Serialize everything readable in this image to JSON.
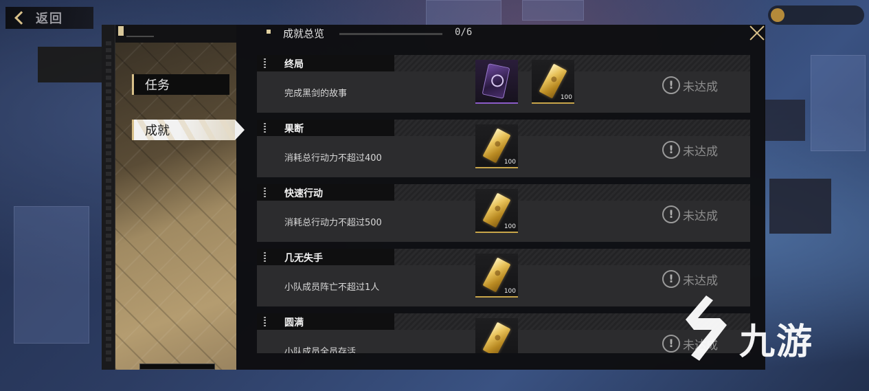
{
  "top_bar": {
    "back_label": "返回"
  },
  "panel": {
    "header": {
      "title": "成就总览",
      "progress": "0/6"
    },
    "nav": [
      {
        "label": "任务",
        "selected": false
      },
      {
        "label": "成就",
        "selected": true
      }
    ]
  },
  "achievements": [
    {
      "title": "终局",
      "desc": "完成黑剑的故事",
      "rewards": [
        {
          "icon": "purple-card-icon",
          "qty": ""
        },
        {
          "icon": "gold-bar-icon",
          "qty": "100"
        }
      ],
      "status": "未达成"
    },
    {
      "title": "果断",
      "desc": "消耗总行动力不超过400",
      "rewards": [
        {
          "icon": "gold-bar-icon",
          "qty": "100"
        }
      ],
      "status": "未达成"
    },
    {
      "title": "快速行动",
      "desc": "消耗总行动力不超过500",
      "rewards": [
        {
          "icon": "gold-bar-icon",
          "qty": "100"
        }
      ],
      "status": "未达成"
    },
    {
      "title": "几无失手",
      "desc": "小队成员阵亡不超过1人",
      "rewards": [
        {
          "icon": "gold-bar-icon",
          "qty": "100"
        }
      ],
      "status": "未达成"
    },
    {
      "title": "圆满",
      "desc": "小队成员全员存活",
      "rewards": [
        {
          "icon": "gold-bar-icon",
          "qty": ""
        }
      ],
      "status": "未达成"
    }
  ],
  "status_icon_glyph": "!",
  "watermark": {
    "text": "九游"
  },
  "colors": {
    "accent_gold": "#d9c18a",
    "reward_border": "#c9a64a",
    "rare_border": "#8c5cc9"
  }
}
